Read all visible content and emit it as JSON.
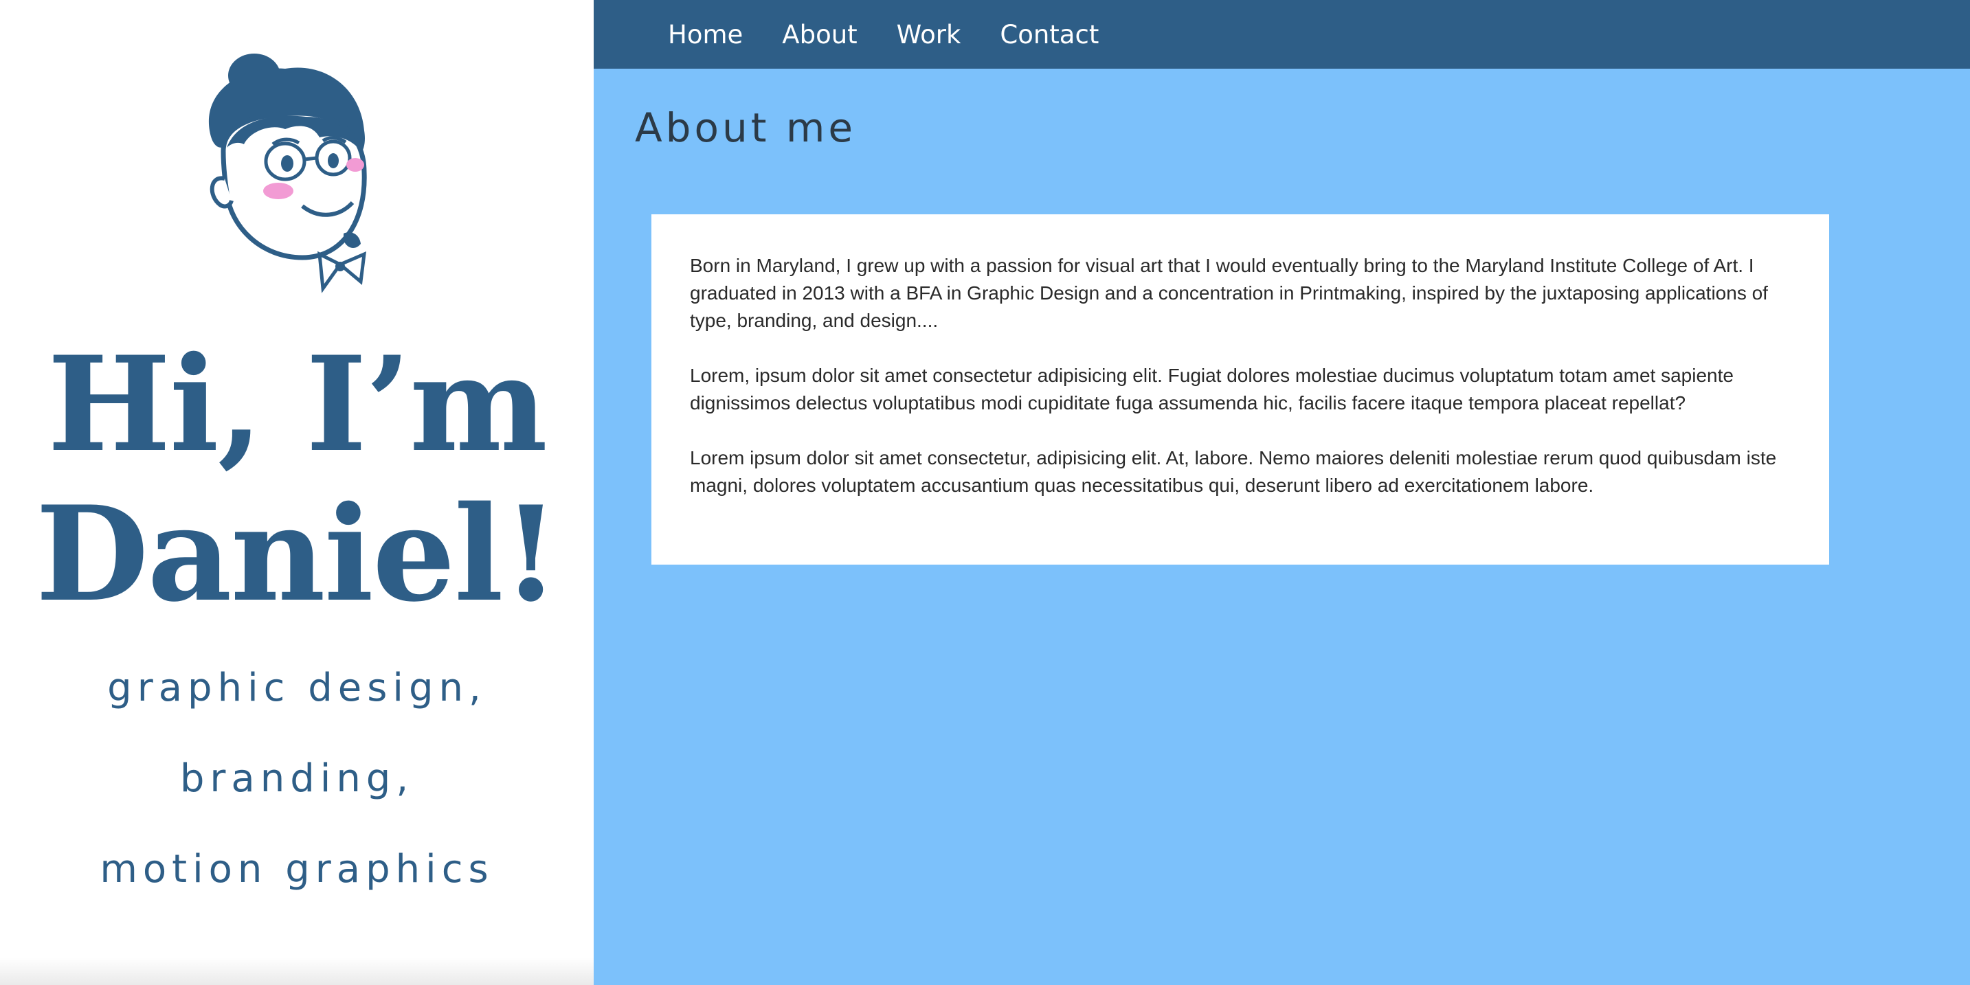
{
  "sidebar": {
    "avatar_icon": "cartoon-avatar-icon",
    "hero_line1": "Hi, I’m",
    "hero_line2": "Daniel!",
    "skills": [
      "graphic design,",
      "branding,",
      "motion graphics"
    ]
  },
  "nav": {
    "items": [
      "Home",
      "About",
      "Work",
      "Contact"
    ]
  },
  "main": {
    "section_title": "About me",
    "paragraphs": [
      "Born in Maryland, I grew up with a passion for visual art that I would eventually bring to the Maryland Institute College of Art. I graduated in 2013 with a BFA in Graphic Design and a concentration in Printmaking, inspired by the juxtaposing applications of type, branding, and design....",
      "Lorem, ipsum dolor sit amet consectetur adipisicing elit. Fugiat dolores molestiae ducimus voluptatum totam amet sapiente dignissimos delectus voluptatibus modi cupiditate fuga assumenda hic, facilis facere itaque tempora placeat repellat?",
      "Lorem ipsum dolor sit amet consectetur, adipisicing elit. At, labore. Nemo maiores deleniti molestiae rerum quod quibusdam iste magni, dolores voluptatem accusantium quas necessitatibus qui, deserunt libero ad exercitationem labore."
    ]
  },
  "colors": {
    "primary": "#2e5e87",
    "background_blue": "#7cc1fb",
    "card": "#ffffff",
    "blush": "#f29bd4"
  }
}
